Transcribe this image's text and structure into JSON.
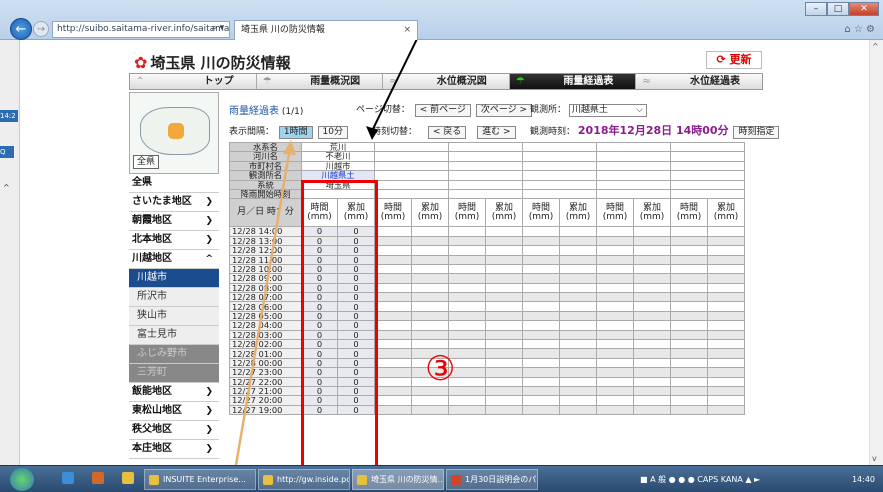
{
  "browser": {
    "url": "http://suibo.saitama-river.info/saitama/servlet/C",
    "search_glyph": "⌕ ▾",
    "tab_title": "埼玉県 川の防災情報",
    "tab_close": "×",
    "right_icons": "⌂ ☆ ⚙",
    "win_min": "–",
    "win_max": "□",
    "win_close": "✕"
  },
  "left_strip": {
    "time_fragment": "14:2",
    "q": "Q"
  },
  "header": {
    "title": "埼玉県 川の防災情報",
    "refresh_label": "更新"
  },
  "nav": {
    "tabs": [
      {
        "label": "トップ"
      },
      {
        "label": "雨量概況図"
      },
      {
        "label": "水位概況図"
      },
      {
        "label": "雨量経過表"
      },
      {
        "label": "水位経過表"
      }
    ]
  },
  "sidebar": {
    "all_button": "全県",
    "items": [
      {
        "label": "全県"
      },
      {
        "label": "さいたま地区"
      },
      {
        "label": "朝霞地区"
      },
      {
        "label": "北本地区"
      },
      {
        "label": "川越地区"
      },
      {
        "label": "川越市"
      },
      {
        "label": "所沢市"
      },
      {
        "label": "狭山市"
      },
      {
        "label": "富士見市"
      },
      {
        "label": "ふじみ野市"
      },
      {
        "label": "三芳町"
      },
      {
        "label": "飯能地区"
      },
      {
        "label": "東松山地区"
      },
      {
        "label": "秩父地区"
      },
      {
        "label": "本庄地区"
      }
    ]
  },
  "content": {
    "page_title": "雨量経過表",
    "page_count": "(1/1)",
    "page_switch_label": "ページ切替：",
    "prev_page": "< 前ページ",
    "next_page": "次ページ >",
    "station_label": "観測所：",
    "station_value": "川越県土",
    "interval_label": "表示間隔：",
    "interval_1h": "1時間",
    "interval_10m": "10分",
    "time_switch_label": "時刻切替：",
    "back": "< 戻る",
    "forward": "進む >",
    "obs_time_label": "観測時刻：",
    "obs_time": "2018年12月28日 14時00分",
    "time_spec": "時刻指定"
  },
  "table": {
    "header_rows": [
      {
        "label": "水系名",
        "value": "荒川"
      },
      {
        "label": "河川名",
        "value": "不老川"
      },
      {
        "label": "市町村名",
        "value": "川越市"
      },
      {
        "label": "観測所名",
        "value": "川越県土"
      },
      {
        "label": "系統",
        "value": "埼玉県"
      },
      {
        "label": "降雨開始時刻",
        "value": ""
      }
    ],
    "unit_label": "月／日 時：分",
    "col_hourly": "時間 (mm)",
    "col_cumulative": "累加 (mm)",
    "rows": [
      {
        "time": "12/28 14:00",
        "h": "0",
        "c": "0"
      },
      {
        "time": "12/28 13:00",
        "h": "0",
        "c": "0"
      },
      {
        "time": "12/28 12:00",
        "h": "0",
        "c": "0"
      },
      {
        "time": "12/28 11:00",
        "h": "0",
        "c": "0"
      },
      {
        "time": "12/28 10:00",
        "h": "0",
        "c": "0"
      },
      {
        "time": "12/28 09:00",
        "h": "0",
        "c": "0"
      },
      {
        "time": "12/28 08:00",
        "h": "0",
        "c": "0"
      },
      {
        "time": "12/28 07:00",
        "h": "0",
        "c": "0"
      },
      {
        "time": "12/28 06:00",
        "h": "0",
        "c": "0"
      },
      {
        "time": "12/28 05:00",
        "h": "0",
        "c": "0"
      },
      {
        "time": "12/28 04:00",
        "h": "0",
        "c": "0"
      },
      {
        "time": "12/28 03:00",
        "h": "0",
        "c": "0"
      },
      {
        "time": "12/28 02:00",
        "h": "0",
        "c": "0"
      },
      {
        "time": "12/28 01:00",
        "h": "0",
        "c": "0"
      },
      {
        "time": "12/28 00:00",
        "h": "0",
        "c": "0"
      },
      {
        "time": "12/27 23:00",
        "h": "0",
        "c": "0"
      },
      {
        "time": "12/27 22:00",
        "h": "0",
        "c": "0"
      },
      {
        "time": "12/27 21:00",
        "h": "0",
        "c": "0"
      },
      {
        "time": "12/27 20:00",
        "h": "0",
        "c": "0"
      },
      {
        "time": "12/27 19:00",
        "h": "0",
        "c": "0"
      }
    ],
    "empty_station_columns": 5
  },
  "annotation": {
    "marker": "③",
    "color": "#e00000"
  },
  "taskbar": {
    "items": [
      {
        "label": "INSUITE Enterprise..."
      },
      {
        "label": "http://gw.inside.pc..."
      },
      {
        "label": "埼玉県 川の防災情..."
      },
      {
        "label": "1月30日説明会のパ..."
      }
    ],
    "tray_text": "A 般",
    "caps": "CAPS",
    "kana": "KANA",
    "clock": "14:40"
  }
}
